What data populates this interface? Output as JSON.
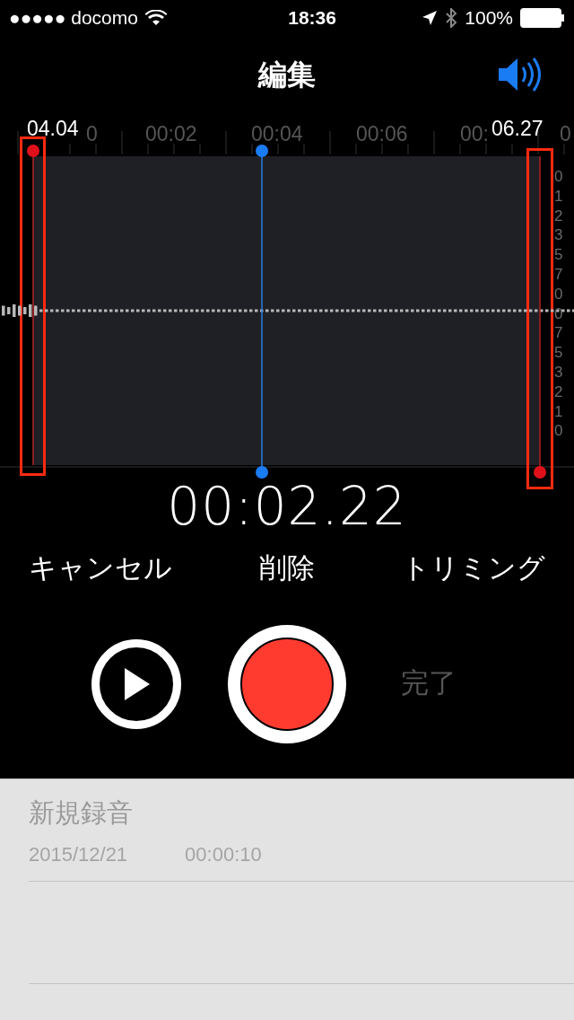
{
  "status_bar": {
    "carrier": "●●●●● docomo",
    "time": "18:36",
    "battery": "100%"
  },
  "nav": {
    "title": "編集"
  },
  "timeline": {
    "start_label": "04.04",
    "end_label": "06.27",
    "ruler_labels": [
      "0",
      "00:02",
      "00:04",
      "00:06",
      "00:",
      "0"
    ],
    "db_scale": [
      "0",
      "1",
      "2",
      "3",
      "5",
      "7",
      "0",
      "0",
      "7",
      "5",
      "3",
      "2",
      "1",
      "0"
    ],
    "start_highlighted": true,
    "end_highlighted": true
  },
  "current_time": "00:02.22",
  "actions": [
    "キャンセル",
    "削除",
    "トリミング"
  ],
  "transport": {
    "done": "完了",
    "done_disabled": true
  },
  "recordings": [
    {
      "name": "新規録音",
      "date": "2015/12/21",
      "duration": "00:00:10"
    }
  ]
}
